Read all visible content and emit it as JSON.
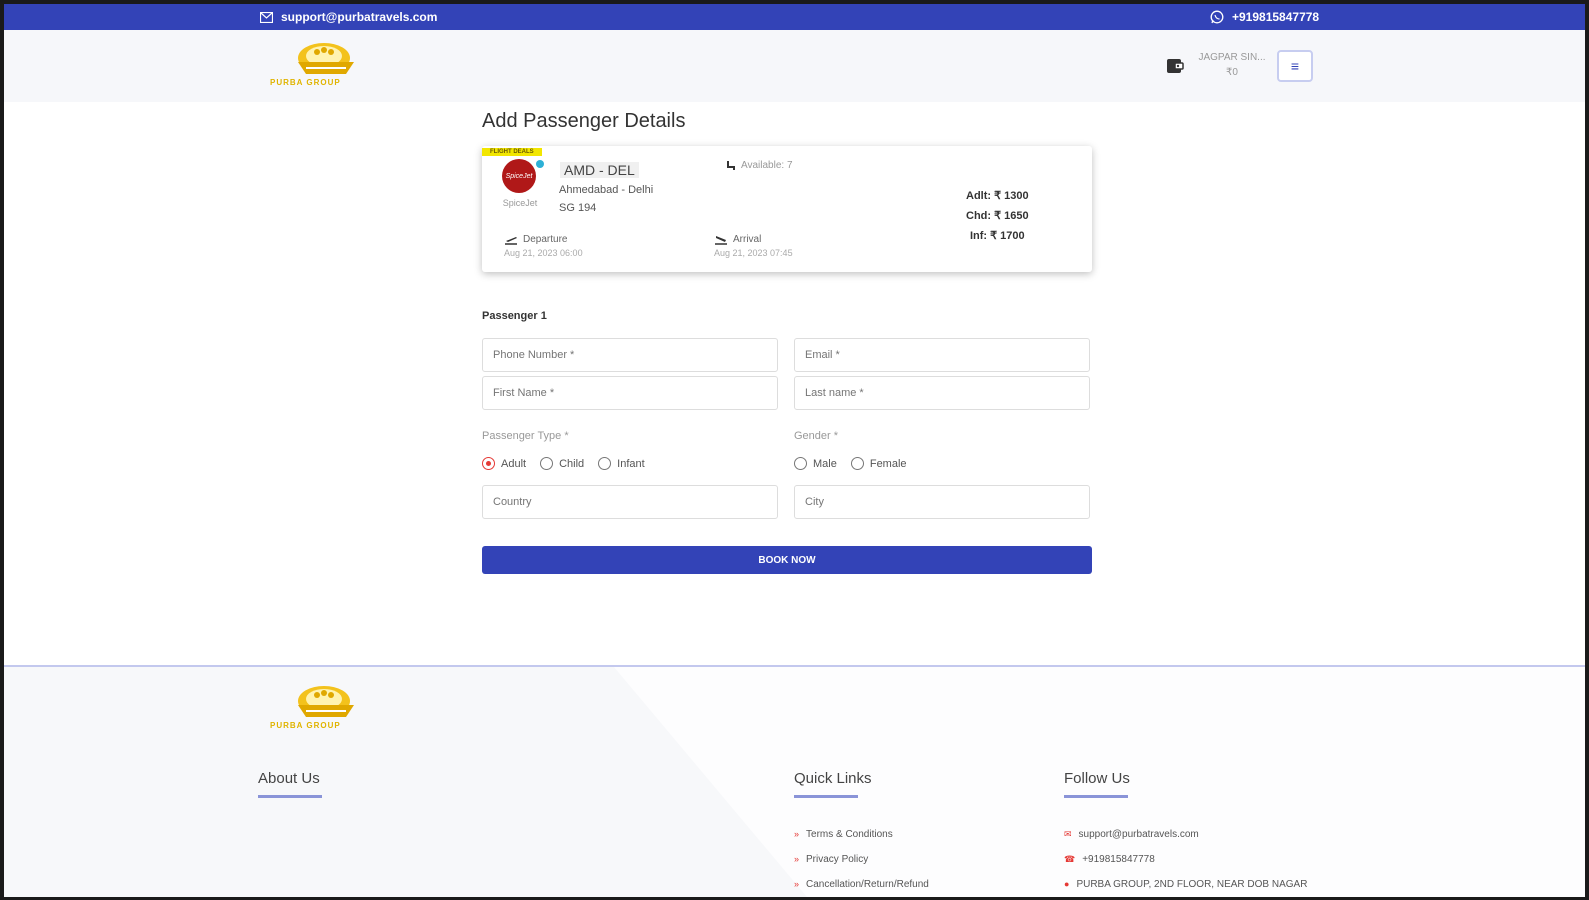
{
  "topbar": {
    "email": "support@purbatravels.com",
    "phone": "+919815847778"
  },
  "header": {
    "logo_text": "PURBA GROUP",
    "user_name": "JAGPAR SIN...",
    "user_balance": "₹0",
    "menu_icon": "menu-icon"
  },
  "page": {
    "title": "Add Passenger Details"
  },
  "flight": {
    "badge": "FLIGHT DEALS",
    "airline_logo_text": "SpiceJet",
    "airline_name": "SpiceJet",
    "route": "AMD - DEL",
    "cities": "Ahmedabad - Delhi",
    "flight_no": "SG 194",
    "seats": "Available: 7",
    "fares": {
      "adult": "Adlt: ₹ 1300",
      "child": "Chd: ₹ 1650",
      "infant": "Inf: ₹ 1700"
    },
    "departure_label": "Departure",
    "departure_time": "Aug 21, 2023 06:00",
    "arrival_label": "Arrival",
    "arrival_time": "Aug 21, 2023 07:45"
  },
  "form": {
    "passenger_label": "Passenger 1",
    "phone_placeholder": "Phone Number *",
    "email_placeholder": "Email *",
    "first_name_placeholder": "First Name *",
    "last_name_placeholder": "Last name *",
    "passenger_type_label": "Passenger Type *",
    "passenger_types": [
      "Adult",
      "Child",
      "Infant"
    ],
    "passenger_type_selected": "Adult",
    "gender_label": "Gender *",
    "genders": [
      "Male",
      "Female"
    ],
    "country_placeholder": "Country",
    "city_placeholder": "City",
    "book_button": "BOOK NOW"
  },
  "footer": {
    "logo_text": "PURBA GROUP",
    "about_heading": "About Us",
    "quick_links_heading": "Quick Links",
    "quick_links": [
      "Terms & Conditions",
      "Privacy Policy",
      "Cancellation/Return/Refund"
    ],
    "follow_heading": "Follow Us",
    "contact_email": "support@purbatravels.com",
    "contact_phone": "+919815847778",
    "contact_address": "PURBA GROUP, 2ND FLOOR, NEAR DOB NAGAR"
  },
  "colors": {
    "primary": "#3343b7",
    "accent": "#e53935",
    "brand_gold": "#e0b400"
  }
}
